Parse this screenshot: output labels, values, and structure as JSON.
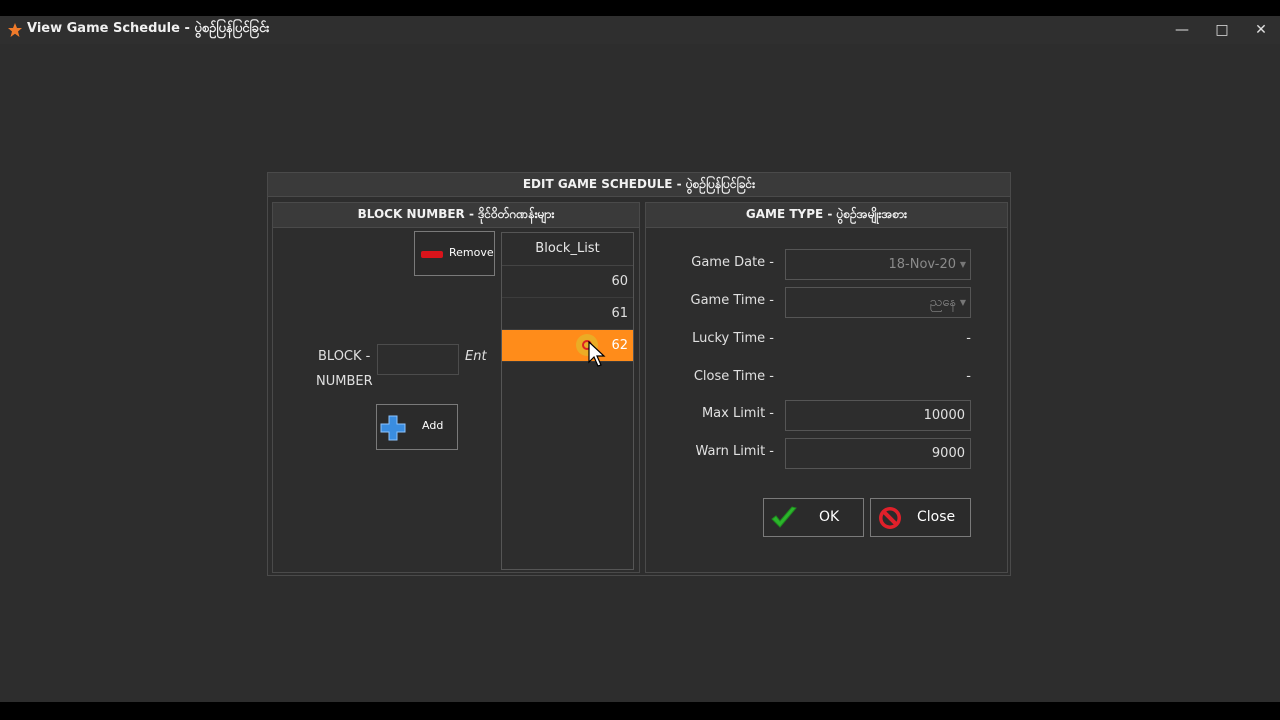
{
  "window": {
    "title": "View Game Schedule - ပွဲစဉ်ပြန်ပြင်ခြင်း"
  },
  "dialog": {
    "title": "EDIT GAME SCHEDULE - ပွဲစဉ်ပြန်ပြင်ခြင်း",
    "block_panel": {
      "header": "BLOCK NUMBER - ဒိုင်ဝိတ်ဂဏန်းများ",
      "remove_label": "Remove",
      "block_label": "BLOCK -",
      "number_label": "NUMBER",
      "block_input_value": "",
      "ent_label": "Ent",
      "add_label": "Add",
      "list_header": "Block_List",
      "items": [
        "60",
        "61",
        "62"
      ],
      "selected_index": 2
    },
    "game_panel": {
      "header": "GAME TYPE - ပွဲစဉ်အမျိုးအစား",
      "game_date_label": "Game Date -",
      "game_date_value": "18-Nov-20",
      "game_time_label": "Game Time -",
      "game_time_value": "ညနေ",
      "lucky_time_label": "Lucky Time -",
      "lucky_time_value": "-",
      "close_time_label": "Close Time -",
      "close_time_value": "-",
      "max_limit_label": "Max Limit -",
      "max_limit_value": "10000",
      "warn_limit_label": "Warn Limit -",
      "warn_limit_value": "9000",
      "ok_label": "OK",
      "close_label": "Close"
    }
  },
  "colors": {
    "background": "#2d2d2d",
    "selected_row": "#ff8c1a",
    "remove_icon": "#d9141b",
    "add_icon": "#3a8de0",
    "ok_icon": "#2bb52b",
    "close_icon": "#e0202a"
  },
  "icons": [
    "star-icon",
    "minimize-icon",
    "maximize-icon",
    "close-icon",
    "minus-icon",
    "plus-icon",
    "checkmark-icon",
    "no-entry-icon",
    "mouse-cursor-icon"
  ]
}
